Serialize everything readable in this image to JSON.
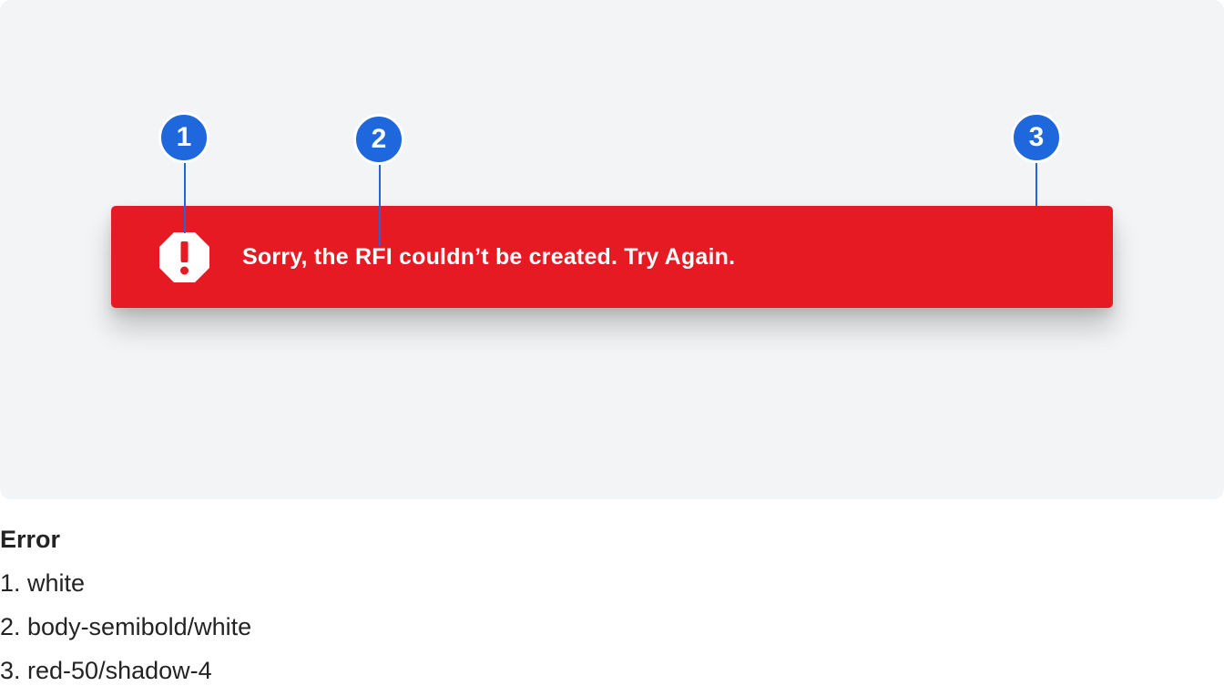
{
  "banner": {
    "message": "Sorry, the RFI couldn’t be created. Try Again.",
    "icon": "error-octagon-icon",
    "icon_glyph": "!"
  },
  "markers": [
    {
      "label": "1"
    },
    {
      "label": "2"
    },
    {
      "label": "3"
    }
  ],
  "legend": {
    "title": "Error",
    "items": [
      "1. white",
      "2. body-semibold/white",
      "3. red-50/shadow-4"
    ]
  },
  "colors": {
    "canvas_bg": "#f3f4f6",
    "banner_bg": "#e51a22",
    "marker_bg": "#1f67dc",
    "marker_border": "#ffffff",
    "leader_line": "#1f67dc",
    "text_dark": "#232323",
    "white": "#ffffff"
  }
}
